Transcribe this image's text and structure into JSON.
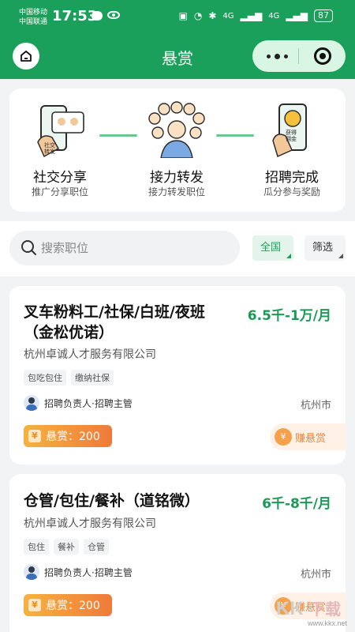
{
  "status_bar": {
    "carrier_1": "中国移动",
    "carrier_2": "中国联通",
    "time": "17:53",
    "signal_1": "4G",
    "signal_2": "4G",
    "battery": "87"
  },
  "header": {
    "title": "悬赏",
    "home_icon": "home-icon",
    "more_icon": "more-dots-icon",
    "close_icon": "close-target-icon",
    "bg_color": "#1aa05a"
  },
  "steps": [
    {
      "title": "社交分享",
      "subtitle": "推广分享职位",
      "badge": "社交转发"
    },
    {
      "title": "接力转发",
      "subtitle": "接力转发职位"
    },
    {
      "title": "招聘完成",
      "subtitle": "瓜分参与奖励",
      "badge": "获得佣金"
    }
  ],
  "search": {
    "placeholder": "搜索职位",
    "area_chip": "全国",
    "filter_chip": "筛选"
  },
  "jobs": [
    {
      "title_line1": "叉车粉料工/社保/白班/夜班",
      "title_line2": "（金松优诺）",
      "salary": "6.5千-1万/月",
      "company": "杭州卓诚人才服务有限公司",
      "tags": [
        "包吃包住",
        "缴纳社保"
      ],
      "recruiter": "招聘负责人·招聘主管",
      "city": "杭州市",
      "reward": "悬赏：200",
      "earn": "赚悬赏"
    },
    {
      "title_line1": "仓管/包住/餐补（道铭微）",
      "salary": "6千-8千/月",
      "company": "杭州卓诚人才服务有限公司",
      "tags": [
        "包住",
        "餐补",
        "仓管"
      ],
      "recruiter": "招聘负责人·招聘主管",
      "city": "杭州市",
      "reward": "悬赏：200",
      "earn": "赚悬赏"
    }
  ],
  "watermark": {
    "text": "www.kkx.net",
    "logo_text": "KK下载"
  },
  "colors": {
    "primary": "#1aa05a",
    "reward": "#f07a3a",
    "salary": "#1a9b55"
  }
}
